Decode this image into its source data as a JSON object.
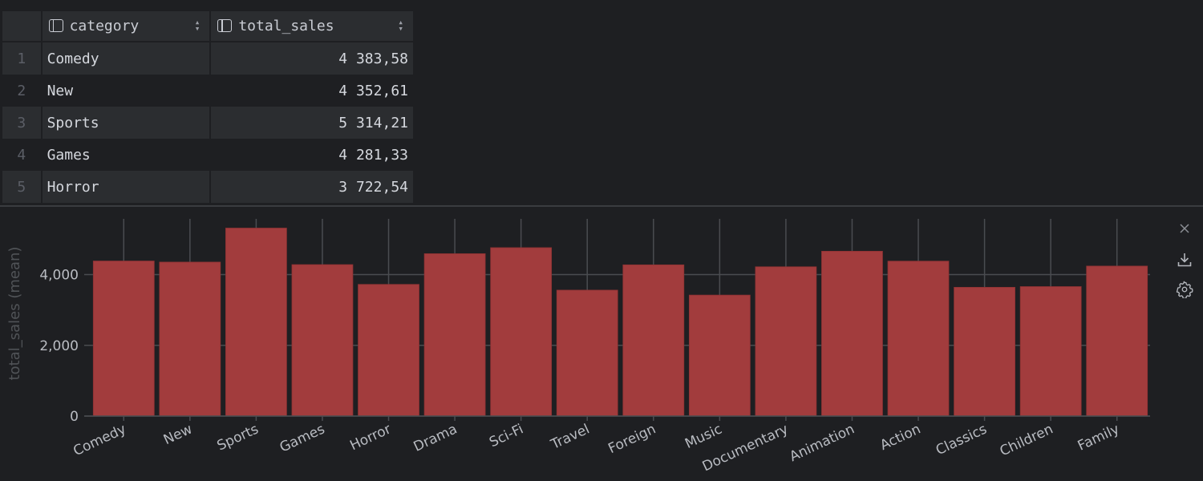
{
  "table": {
    "columns": [
      {
        "name": "category",
        "icon": "column-icon",
        "sort_icon": "sort-icon"
      },
      {
        "name": "total_sales",
        "icon": "column-icon",
        "sort_icon": "sort-icon"
      }
    ],
    "rows": [
      {
        "num": "1",
        "category": "Comedy",
        "total_sales": "4 383,58"
      },
      {
        "num": "2",
        "category": "New",
        "total_sales": "4 352,61"
      },
      {
        "num": "3",
        "category": "Sports",
        "total_sales": "5 314,21"
      },
      {
        "num": "4",
        "category": "Games",
        "total_sales": "4 281,33"
      },
      {
        "num": "5",
        "category": "Horror",
        "total_sales": "3 722,54"
      }
    ]
  },
  "toolbar": {
    "close_icon": "close-icon",
    "download_icon": "download-icon",
    "settings_icon": "gear-icon"
  },
  "colors": {
    "bar": "#a23c3d",
    "background": "#1e1f22",
    "grid": "#4a4c50",
    "tick_text": "#b9bcc2",
    "axis_label": "#505357"
  },
  "chart_data": {
    "type": "bar",
    "title": "",
    "xlabel": "",
    "ylabel": "total_sales (mean)",
    "categories": [
      "Comedy",
      "New",
      "Sports",
      "Games",
      "Horror",
      "Drama",
      "Sci-Fi",
      "Travel",
      "Foreign",
      "Music",
      "Documentary",
      "Animation",
      "Action",
      "Classics",
      "Children",
      "Family"
    ],
    "values": [
      4383.58,
      4352.61,
      5314.21,
      4281.33,
      3722.54,
      4590,
      4760,
      3560,
      4275,
      3420,
      4220,
      4660,
      4380,
      3640,
      3660,
      4240
    ],
    "ylim": [
      0,
      5800
    ],
    "yticks": [
      0,
      2000,
      4000
    ],
    "ytick_labels": [
      "0",
      "2,000",
      "4,000"
    ],
    "grid": true,
    "legend": "none"
  }
}
